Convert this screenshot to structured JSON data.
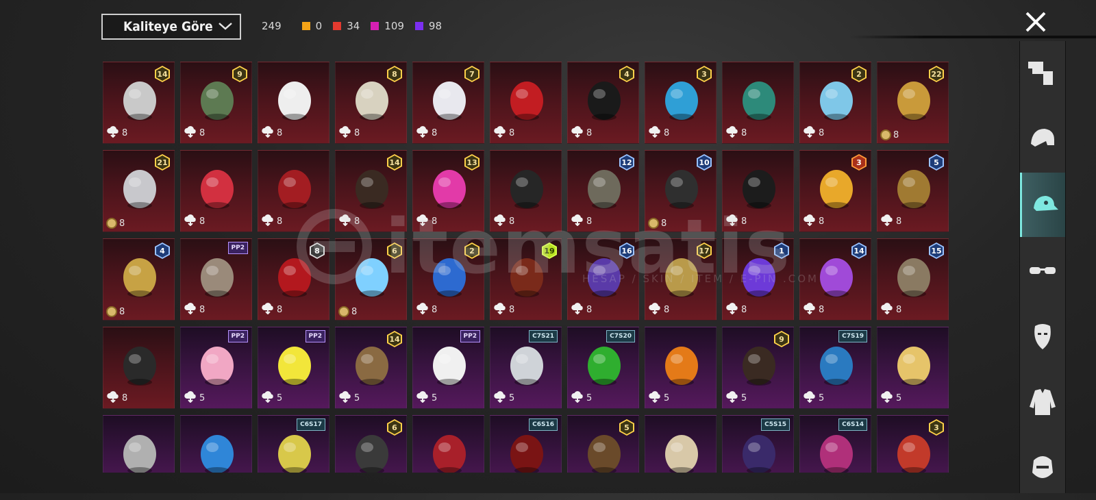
{
  "header": {
    "sort_label": "Kaliteye Göre",
    "total_count": "249",
    "rarity_counts": [
      {
        "color": "#f4a317",
        "count": "0"
      },
      {
        "color": "#e33a2f",
        "count": "34"
      },
      {
        "color": "#d61fb3",
        "count": "109"
      },
      {
        "color": "#7b2ff0",
        "count": "98"
      }
    ]
  },
  "watermark": {
    "text": "itemsatis",
    "subtitle": "HESAP / SKIN / ITEM / E-PIN .COM"
  },
  "sidebar": {
    "items": [
      {
        "name": "outfit-icon",
        "active": false
      },
      {
        "name": "helmet-icon",
        "active": false
      },
      {
        "name": "cap-icon",
        "active": true
      },
      {
        "name": "glasses-icon",
        "active": false
      },
      {
        "name": "mask-icon",
        "active": false
      },
      {
        "name": "jacket-icon",
        "active": false
      },
      {
        "name": "face-icon",
        "active": false
      }
    ]
  },
  "items": [
    {
      "tone": "red",
      "badge": "14",
      "badge_style": "gold",
      "cost": "8",
      "currency": "cloud",
      "art": "wolf-mask-hood"
    },
    {
      "tone": "red",
      "badge": "9",
      "badge_style": "gold",
      "cost": "8",
      "currency": "cloud",
      "art": "zombie-head"
    },
    {
      "tone": "red",
      "badge": "",
      "cost": "8",
      "currency": "cloud",
      "art": "white-cowboy-hat"
    },
    {
      "tone": "red",
      "badge": "8",
      "badge_style": "gold",
      "cost": "8",
      "currency": "cloud",
      "art": "winged-helmet"
    },
    {
      "tone": "red",
      "badge": "7",
      "badge_style": "gold",
      "cost": "8",
      "currency": "cloud",
      "art": "white-long-hair"
    },
    {
      "tone": "red",
      "badge": "",
      "cost": "8",
      "currency": "cloud",
      "art": "red-helmet"
    },
    {
      "tone": "red",
      "badge": "4",
      "badge_style": "gold",
      "cost": "8",
      "currency": "cloud",
      "art": "snowman-top-hat"
    },
    {
      "tone": "red",
      "badge": "3",
      "badge_style": "gold",
      "cost": "8",
      "currency": "cloud",
      "art": "blue-afro-clown"
    },
    {
      "tone": "red",
      "badge": "",
      "cost": "8",
      "currency": "cloud",
      "art": "dragon-helmet"
    },
    {
      "tone": "red",
      "badge": "2",
      "badge_style": "gold",
      "cost": "8",
      "currency": "cloud",
      "art": "ice-hat"
    },
    {
      "tone": "red",
      "badge": "22",
      "badge_style": "gold",
      "cost": "8",
      "currency": "coin",
      "art": "golden-helmet"
    },
    {
      "tone": "red",
      "badge": "21",
      "badge_style": "gold",
      "cost": "8",
      "currency": "coin",
      "art": "clown-mask"
    },
    {
      "tone": "red",
      "badge": "",
      "cost": "8",
      "currency": "cloud",
      "art": "fox-mask"
    },
    {
      "tone": "red",
      "badge": "",
      "cost": "8",
      "currency": "cloud",
      "art": "red-cyber-helmet"
    },
    {
      "tone": "red",
      "badge": "14",
      "badge_style": "gold",
      "cost": "8",
      "currency": "cloud",
      "art": "horned-helmet"
    },
    {
      "tone": "red",
      "badge": "13",
      "badge_style": "gold",
      "cost": "8",
      "currency": "cloud",
      "art": "pink-dreads-mask"
    },
    {
      "tone": "red",
      "badge": "",
      "cost": "8",
      "currency": "cloud",
      "art": "dark-hood"
    },
    {
      "tone": "red",
      "badge": "12",
      "badge_style": "blue",
      "cost": "8",
      "currency": "cloud",
      "art": "blade-helmet"
    },
    {
      "tone": "red",
      "badge": "10",
      "badge_style": "blue",
      "cost": "8",
      "currency": "coin",
      "art": "plague-mask"
    },
    {
      "tone": "red",
      "badge": "",
      "cost": "8",
      "currency": "cloud",
      "art": "black-helmet"
    },
    {
      "tone": "red",
      "badge": "3",
      "badge_style": "orange",
      "cost": "8",
      "currency": "cloud",
      "art": "fries-hat"
    },
    {
      "tone": "red",
      "badge": "5",
      "badge_style": "blue",
      "cost": "8",
      "currency": "cloud",
      "art": "golden-mech-helmet"
    },
    {
      "tone": "red",
      "badge": "4",
      "badge_style": "blue",
      "cost": "8",
      "currency": "coin",
      "art": "gold-horned-helmet"
    },
    {
      "tone": "red",
      "badge": "",
      "tag": "PP2",
      "tag_style": "pp",
      "cost": "8",
      "currency": "cloud",
      "art": "feather-bonnet"
    },
    {
      "tone": "red",
      "badge": "8",
      "badge_style": "silver",
      "cost": "8",
      "currency": "cloud",
      "art": "red-witch-hat"
    },
    {
      "tone": "red",
      "badge": "6",
      "badge_style": "gold",
      "cost": "8",
      "currency": "coin",
      "art": "ice-crown"
    },
    {
      "tone": "red",
      "badge": "2",
      "badge_style": "gold",
      "cost": "8",
      "currency": "cloud",
      "art": "blue-mech-mask"
    },
    {
      "tone": "red",
      "badge": "19",
      "badge_style": "lime",
      "cost": "8",
      "currency": "cloud",
      "art": "samurai-helmet"
    },
    {
      "tone": "red",
      "badge": "16",
      "badge_style": "blue",
      "cost": "8",
      "currency": "cloud",
      "art": "purple-knight-helmet"
    },
    {
      "tone": "red",
      "badge": "17",
      "badge_style": "gold",
      "cost": "8",
      "currency": "cloud",
      "art": "gold-visor-helmet"
    },
    {
      "tone": "red",
      "badge": "1",
      "badge_style": "blue",
      "cost": "8",
      "currency": "cloud",
      "art": "neon-helmet"
    },
    {
      "tone": "red",
      "badge": "14",
      "badge_style": "blue",
      "cost": "8",
      "currency": "cloud",
      "art": "purple-crystal"
    },
    {
      "tone": "red",
      "badge": "15",
      "badge_style": "blue",
      "cost": "8",
      "currency": "cloud",
      "art": "chain-helmet"
    },
    {
      "tone": "red",
      "badge": "",
      "cost": "8",
      "currency": "cloud",
      "art": "pirate-hat"
    },
    {
      "tone": "purple",
      "badge": "",
      "tag": "PP2",
      "tag_style": "pp",
      "cost": "5",
      "currency": "cloud",
      "art": "pink-bow-headband"
    },
    {
      "tone": "purple",
      "badge": "",
      "tag": "PP2",
      "tag_style": "pp",
      "cost": "5",
      "currency": "cloud",
      "art": "yellow-box-head"
    },
    {
      "tone": "purple",
      "badge": "14",
      "badge_style": "gold",
      "cost": "5",
      "currency": "cloud",
      "art": "brown-hair"
    },
    {
      "tone": "purple",
      "badge": "",
      "tag": "PP2",
      "tag_style": "pp",
      "cost": "5",
      "currency": "cloud",
      "art": "panda-head"
    },
    {
      "tone": "purple",
      "badge": "",
      "tag": "C7S21",
      "tag_style": "cs",
      "cost": "5",
      "currency": "cloud",
      "art": "silver-hair"
    },
    {
      "tone": "purple",
      "badge": "",
      "tag": "C7S20",
      "tag_style": "cs",
      "cost": "5",
      "currency": "cloud",
      "art": "green-pigtails"
    },
    {
      "tone": "purple",
      "badge": "",
      "cost": "5",
      "currency": "cloud",
      "art": "pumpkin-head"
    },
    {
      "tone": "purple",
      "badge": "9",
      "badge_style": "gold",
      "cost": "5",
      "currency": "cloud",
      "art": "dark-ponytail"
    },
    {
      "tone": "purple",
      "badge": "",
      "tag": "C7S19",
      "tag_style": "cs",
      "cost": "5",
      "currency": "cloud",
      "art": "blue-braids"
    },
    {
      "tone": "purple",
      "badge": "",
      "cost": "5",
      "currency": "cloud",
      "art": "blonde-hair"
    },
    {
      "tone": "purple",
      "badge": "",
      "cost": "",
      "currency": "none",
      "art": "grey-hood"
    },
    {
      "tone": "purple",
      "badge": "",
      "cost": "",
      "currency": "none",
      "art": "blue-cat-cap"
    },
    {
      "tone": "purple",
      "badge": "",
      "tag": "C6S17",
      "tag_style": "cs",
      "cost": "",
      "currency": "none",
      "art": "visor-spiky-hair"
    },
    {
      "tone": "purple",
      "badge": "6",
      "badge_style": "gold",
      "cost": "",
      "currency": "none",
      "art": "bird-mask"
    },
    {
      "tone": "purple",
      "badge": "",
      "cost": "",
      "currency": "none",
      "art": "red-blue-hair"
    },
    {
      "tone": "purple",
      "badge": "",
      "tag": "C6S16",
      "tag_style": "cs",
      "cost": "",
      "currency": "none",
      "art": "red-hood"
    },
    {
      "tone": "purple",
      "badge": "5",
      "badge_style": "gold",
      "cost": "",
      "currency": "none",
      "art": "brown-curls"
    },
    {
      "tone": "purple",
      "badge": "",
      "cost": "",
      "currency": "none",
      "art": "blonde-curls"
    },
    {
      "tone": "purple",
      "badge": "",
      "tag": "C5S15",
      "tag_style": "cs",
      "cost": "",
      "currency": "none",
      "art": "purple-cap"
    },
    {
      "tone": "purple",
      "badge": "",
      "tag": "C6S14",
      "tag_style": "cs",
      "cost": "",
      "currency": "none",
      "art": "magenta-hair"
    },
    {
      "tone": "purple",
      "badge": "3",
      "badge_style": "gold",
      "cost": "",
      "currency": "none",
      "art": "jester-hat"
    }
  ],
  "art_colors": {
    "wolf-mask-hood": "#c9c9c9",
    "zombie-head": "#5d7a52",
    "white-cowboy-hat": "#eeeeee",
    "winged-helmet": "#d8d2c0",
    "white-long-hair": "#e8e8ee",
    "red-helmet": "#c21d22",
    "snowman-top-hat": "#1a1a1a",
    "blue-afro-clown": "#2f9fd6",
    "dragon-helmet": "#2d8a7a",
    "ice-hat": "#7fc7e8",
    "golden-helmet": "#c99a3a",
    "clown-mask": "#c8c8cc",
    "fox-mask": "#d23040",
    "red-cyber-helmet": "#a31d22",
    "horned-helmet": "#3a2a22",
    "pink-dreads-mask": "#e23aa8",
    "dark-hood": "#262626",
    "blade-helmet": "#6e6a5c",
    "plague-mask": "#2f2f2f",
    "black-helmet": "#1c1c1c",
    "fries-hat": "#e8a82a",
    "golden-mech-helmet": "#a07a32",
    "gold-horned-helmet": "#c7a244",
    "feather-bonnet": "#9a8a7a",
    "red-witch-hat": "#b3181e",
    "ice-crown": "#7fd0ff",
    "blue-mech-mask": "#2d6ad0",
    "samurai-helmet": "#7a2a1a",
    "purple-knight-helmet": "#5a3aa8",
    "gold-visor-helmet": "#b99a4a",
    "neon-helmet": "#6d3ad8",
    "purple-crystal": "#a04ad8",
    "chain-helmet": "#8a7a62",
    "pirate-hat": "#2a2a2a",
    "pink-bow-headband": "#f1a7c4",
    "yellow-box-head": "#f2e63a",
    "brown-hair": "#8a6a42",
    "panda-head": "#f0f0f0",
    "silver-hair": "#cfd3d8",
    "green-pigtails": "#2fae2f",
    "pumpkin-head": "#e47a18",
    "dark-ponytail": "#3a2a22",
    "blue-braids": "#2a7ac0",
    "blonde-hair": "#e6c46a",
    "grey-hood": "#b0b0b0",
    "blue-cat-cap": "#2f86d8",
    "visor-spiky-hair": "#d8c84a",
    "bird-mask": "#3a3a3a",
    "red-blue-hair": "#a8202a",
    "red-hood": "#7a1414",
    "brown-curls": "#6a4a2a",
    "blonde-curls": "#d8c8a8",
    "purple-cap": "#3a2a6a",
    "magenta-hair": "#b0307a",
    "jester-hat": "#c23a2a"
  }
}
